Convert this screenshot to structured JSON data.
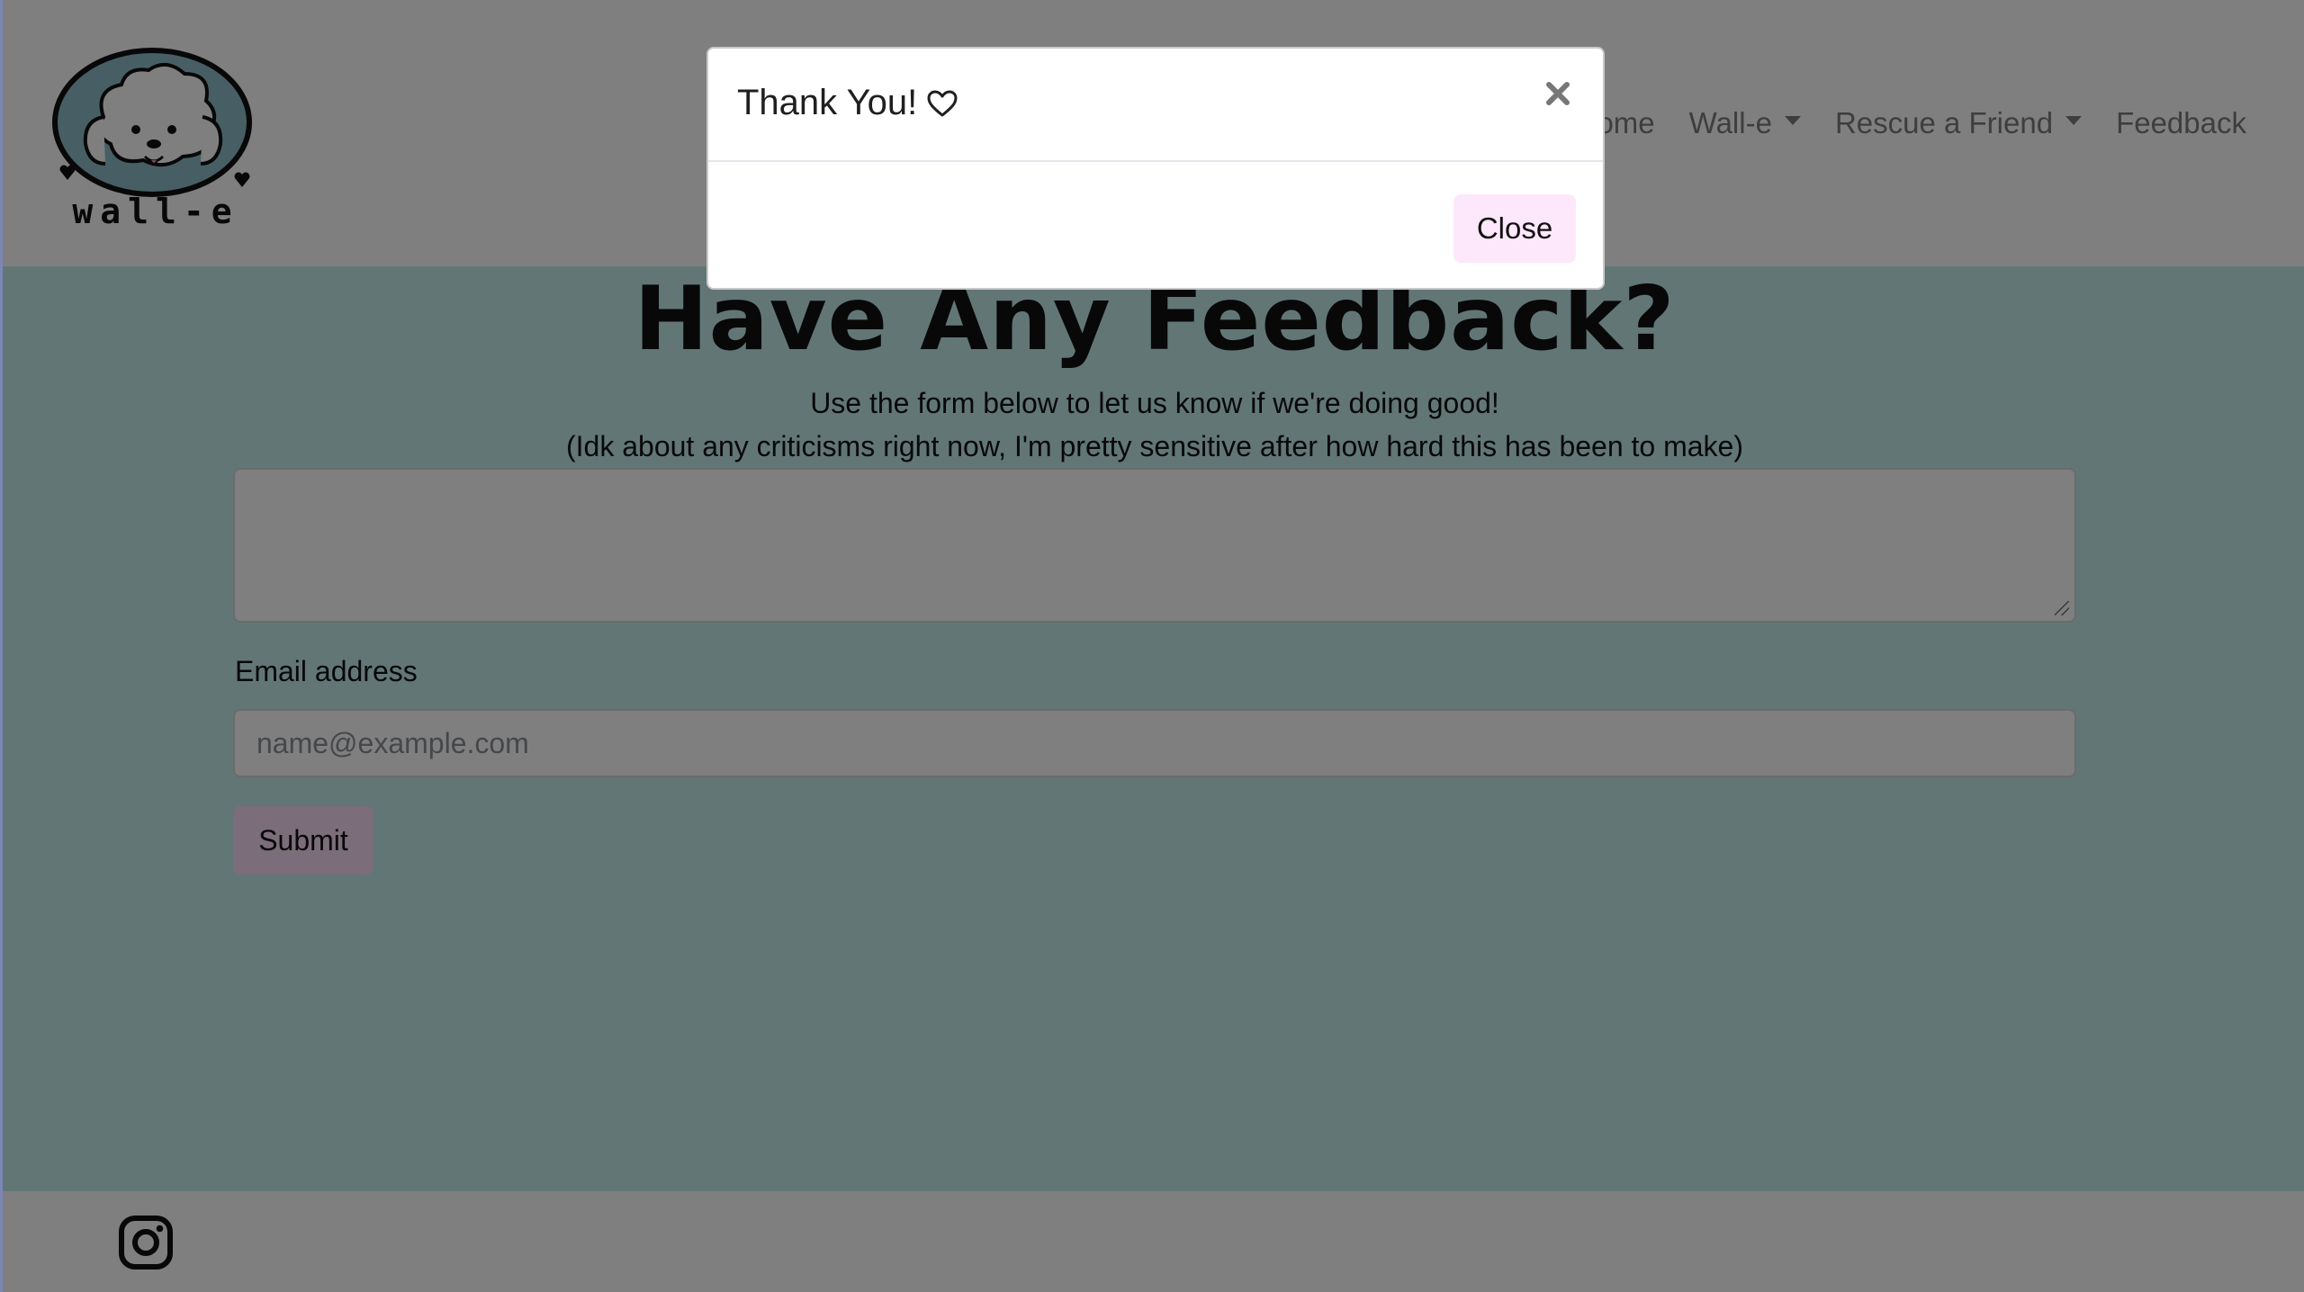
{
  "navbar": {
    "logo_alt": "Wall-e logo",
    "logo_text": "wall-e",
    "links": [
      {
        "label": "Home",
        "dropdown": false
      },
      {
        "label": "Wall-e",
        "dropdown": true
      },
      {
        "label": "Rescue a Friend",
        "dropdown": true
      },
      {
        "label": "Feedback",
        "dropdown": false
      }
    ]
  },
  "main": {
    "title": "Have Any Feedback?",
    "subtitle_1": "Use the form below to let us know if we're doing good!",
    "subtitle_2": "(Idk about any criticisms right now, I'm pretty sensitive after how hard this has been to make)",
    "feedback_value": "",
    "email_label": "Email address",
    "email_value": "",
    "email_placeholder": "name@example.com",
    "submit_label": "Submit"
  },
  "footer": {
    "icon": "instagram-icon"
  },
  "modal": {
    "title": "Thank You!",
    "title_icon": "heart-icon",
    "close_icon": "close-icon",
    "close_label": "Close"
  },
  "colors": {
    "page_background": "#c4eded",
    "button_pink": "#f7dbf4",
    "logo_fill": "#8fbfc8",
    "backdrop": "rgba(0,0,0,0.5)"
  }
}
